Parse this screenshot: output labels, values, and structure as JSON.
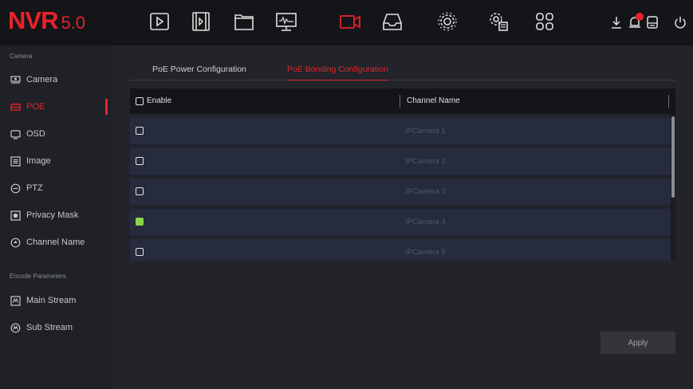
{
  "app": {
    "logo": "NVR",
    "version": "5.0"
  },
  "topnav": {
    "icons": [
      "playback-icon",
      "video-clip-icon",
      "files-icon",
      "monitor-icon",
      "camera-icon",
      "storage-icon",
      "settings-icon",
      "system-icon",
      "multiview-icon"
    ],
    "active": "camera-icon",
    "accent": "#e8232a"
  },
  "sidebar": {
    "section_camera": "Camera",
    "section_encode": "Encode Parameters",
    "items": [
      {
        "label": "Camera",
        "icon": "camera-icon"
      },
      {
        "label": "POE",
        "icon": "poe-icon"
      },
      {
        "label": "OSD",
        "icon": "osd-icon"
      },
      {
        "label": "Image",
        "icon": "image-icon"
      },
      {
        "label": "PTZ",
        "icon": "ptz-icon"
      },
      {
        "label": "Privacy Mask",
        "icon": "privacy-mask-icon"
      },
      {
        "label": "Channel Name",
        "icon": "channel-name-icon"
      },
      {
        "label": "Main Stream",
        "icon": "main-stream-icon"
      },
      {
        "label": "Sub Stream",
        "icon": "sub-stream-icon"
      }
    ]
  },
  "tabs": [
    {
      "label": "PoE Power Configuration"
    },
    {
      "label": "PoE Bonding Configuration"
    }
  ],
  "table": {
    "col_enable": "Enable",
    "col_channel": "Channel Name",
    "rows": [
      {
        "channel": "IPCamera 1",
        "enabled": false
      },
      {
        "channel": "IPCamera 2",
        "enabled": false
      },
      {
        "channel": "IPCamera 3",
        "enabled": false
      },
      {
        "channel": "IPCamera 4",
        "enabled": true
      },
      {
        "channel": "IPCamera 5",
        "enabled": false
      }
    ]
  },
  "apply_label": "Apply"
}
